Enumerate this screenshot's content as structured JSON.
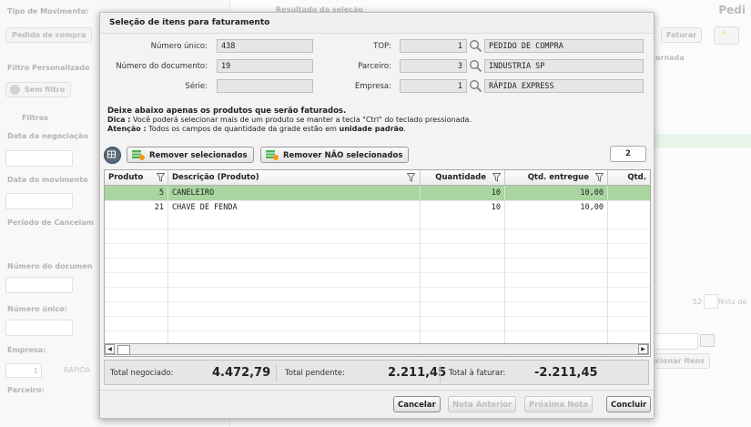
{
  "background": {
    "left_labels": [
      "Tipo de Movimento:",
      "Filtro Personalizado",
      "Data da negociação",
      "Data do movimento",
      "Período de Cancelam",
      "Número do documen",
      "Número único:",
      "Empresa:",
      "Parceiro:"
    ],
    "left_buttons": {
      "pedido": "Pedido de compra",
      "sem_filtro": "Sem filtro",
      "filtros": "Filtros"
    },
    "empresa_value": "1",
    "empresa_name": "RÁPIDA",
    "right_title": "Resultado da seleção",
    "right_header_title": "Pedi",
    "faturar_label": "Faturar",
    "col_header": "ornada",
    "nota_value": "52",
    "nota_label": "Nota de",
    "selecionar_label": "ecionar Itens"
  },
  "modal": {
    "title": "Seleção de itens para faturamento",
    "fields": {
      "numero_unico_label": "Número único:",
      "numero_unico": "438",
      "numero_documento_label": "Número do documento:",
      "numero_documento": "19",
      "serie_label": "Série:",
      "serie": "",
      "top_label": "TOP:",
      "top_code": "1",
      "top_name": "PEDIDO DE COMPRA",
      "parceiro_label": "Parceiro:",
      "parceiro_code": "3",
      "parceiro_name": "INDUSTRIA SP",
      "empresa_label": "Empresa:",
      "empresa_code": "1",
      "empresa_name": "RÁPIDA EXPRESS"
    },
    "notes": {
      "line1": "Deixe abaixo apenas os produtos que serão faturados.",
      "dica_label": "Dica :",
      "dica_text": " Você poderá selecionar mais de um produto se manter a tecla \"Ctrl\" do teclado pressionada.",
      "atencao_label": "Atenção :",
      "atencao_text": " Todos os campos de quantidade da grade estão em ",
      "atencao_bold": "unidade padrão",
      "atencao_end": "."
    },
    "toolbar": {
      "remove_selected": "Remover selecionados",
      "remove_not_selected": "Remover NÃO selecionados",
      "count": "2"
    },
    "grid": {
      "columns": [
        "Produto",
        "Descrição (Produto)",
        "Quantidade",
        "Qtd. entregue",
        "Qtd."
      ],
      "rows": [
        {
          "produto": "5",
          "descricao": "CANELEIRO",
          "quantidade": "10",
          "entregue": "10,00",
          "qtd": "",
          "selected": true
        },
        {
          "produto": "21",
          "descricao": "CHAVE DE FENDA",
          "quantidade": "10",
          "entregue": "10,00",
          "qtd": "",
          "selected": false
        }
      ]
    },
    "totals": {
      "negociado_label": "Total negociado:",
      "negociado": "4.472,79",
      "pendente_label": "Total pendente:",
      "pendente": "2.211,45",
      "faturar_label": "Total à faturar:",
      "faturar": "-2.211,45"
    },
    "footer": {
      "cancelar": "Cancelar",
      "nota_anterior": "Nota Anterior",
      "proxima_nota": "Próxima Nota",
      "concluir": "Concluir"
    }
  },
  "colors": {
    "selected_row": "#a8d5a0",
    "icon_green": "#4caf50",
    "icon_orange": "#f39c12"
  }
}
